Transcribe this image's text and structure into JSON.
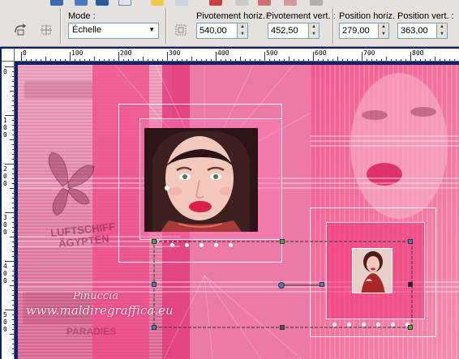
{
  "toolbar": {
    "mode_label": "Mode :",
    "mode_value": "Échelle",
    "fields": [
      {
        "label": "Pivotement horiz. :",
        "value": "540,00"
      },
      {
        "label": "Pivotement vert. :",
        "value": "452,50"
      },
      {
        "label": "Position horiz. :",
        "value": "279,00"
      },
      {
        "label": "Position vert. :",
        "value": "363,00"
      }
    ]
  },
  "ruler_h": [
    "0",
    "100",
    "200",
    "300",
    "400",
    "500",
    "600",
    "700",
    "800"
  ],
  "ruler_v": [
    "0",
    "1 0 0",
    "2 0 0",
    "3 0 0",
    "4 0 0",
    "5 0 0"
  ],
  "canvas": {
    "watermark_line1": "Pinuccia",
    "watermark_line2": "www.maldiregraffica.eu",
    "poster_text_1": "LUFTSCHIFF",
    "poster_text_2": "ÄGYPTEN",
    "poster_text_3": "PARADIES"
  },
  "colors": {
    "accent_pink": "#e8508e",
    "handle_green": "#3cb043",
    "handle_blue": "#4a7ab8"
  }
}
